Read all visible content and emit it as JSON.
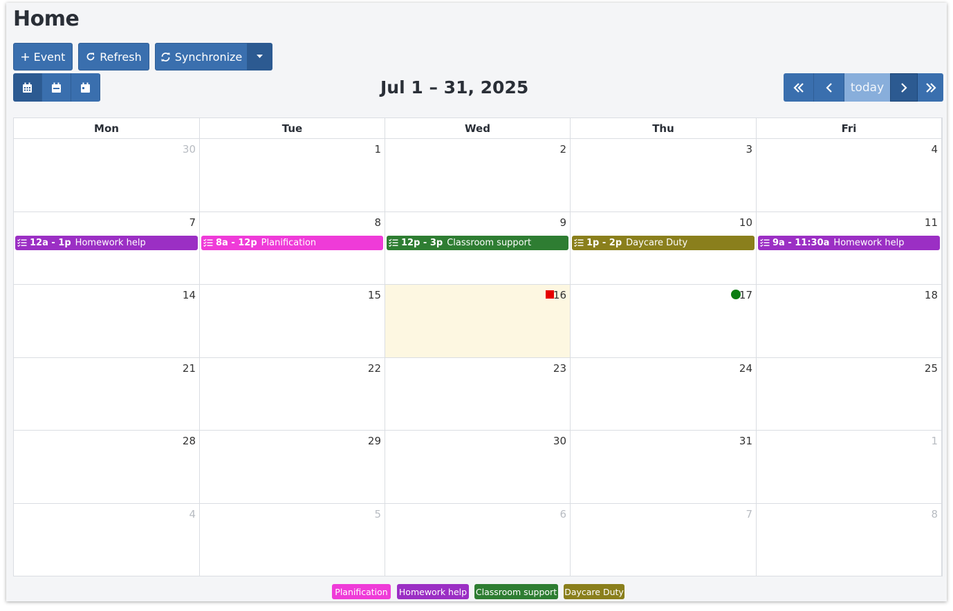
{
  "page": {
    "title": "Home"
  },
  "toolbar": {
    "event_label": "Event",
    "refresh_label": "Refresh",
    "sync_label": "Synchronize"
  },
  "calendar": {
    "range_title": "Jul 1 – 31, 2025",
    "today_label": "today",
    "weekdays": [
      "Mon",
      "Tue",
      "Wed",
      "Thu",
      "Fri"
    ],
    "weeks": [
      [
        {
          "day": "30",
          "other": true
        },
        {
          "day": "1"
        },
        {
          "day": "2"
        },
        {
          "day": "3"
        },
        {
          "day": "4"
        }
      ],
      [
        {
          "day": "7"
        },
        {
          "day": "8"
        },
        {
          "day": "9"
        },
        {
          "day": "10"
        },
        {
          "day": "11"
        }
      ],
      [
        {
          "day": "14"
        },
        {
          "day": "15"
        },
        {
          "day": "16",
          "today": true,
          "marker": "square"
        },
        {
          "day": "17",
          "marker": "dot"
        },
        {
          "day": "18"
        }
      ],
      [
        {
          "day": "21"
        },
        {
          "day": "22"
        },
        {
          "day": "23"
        },
        {
          "day": "24"
        },
        {
          "day": "25"
        }
      ],
      [
        {
          "day": "28"
        },
        {
          "day": "29"
        },
        {
          "day": "30"
        },
        {
          "day": "31"
        },
        {
          "day": "1",
          "other": true
        }
      ],
      [
        {
          "day": "4",
          "other": true
        },
        {
          "day": "5",
          "other": true
        },
        {
          "day": "6",
          "other": true
        },
        {
          "day": "7",
          "other": true
        },
        {
          "day": "8",
          "other": true
        }
      ]
    ],
    "events": [
      {
        "week": 1,
        "col": 0,
        "time": "12a - 1p",
        "title": "Homework help",
        "color": "#9b2fc4"
      },
      {
        "week": 1,
        "col": 1,
        "time": "8a - 12p",
        "title": "Planification",
        "color": "#ef3bd8"
      },
      {
        "week": 1,
        "col": 2,
        "time": "12p - 3p",
        "title": "Classroom support",
        "color": "#2e7d32"
      },
      {
        "week": 1,
        "col": 3,
        "time": "1p - 2p",
        "title": "Daycare Duty",
        "color": "#8a7f1c"
      },
      {
        "week": 1,
        "col": 4,
        "time": "9a - 11:30a",
        "title": "Homework help",
        "color": "#9b2fc4"
      }
    ]
  },
  "legend": [
    {
      "label": "Planification",
      "color": "#ef3bd8"
    },
    {
      "label": "Homework help",
      "color": "#9b2fc4"
    },
    {
      "label": "Classroom support",
      "color": "#2e7d32"
    },
    {
      "label": "Daycare Duty",
      "color": "#8a7f1c"
    }
  ],
  "colors": {
    "primary": "#3a6fae",
    "primary_dark": "#2c5a91",
    "today_bg": "#fdf7e1",
    "marker_red": "#e60000",
    "marker_green": "#0a7d12"
  }
}
